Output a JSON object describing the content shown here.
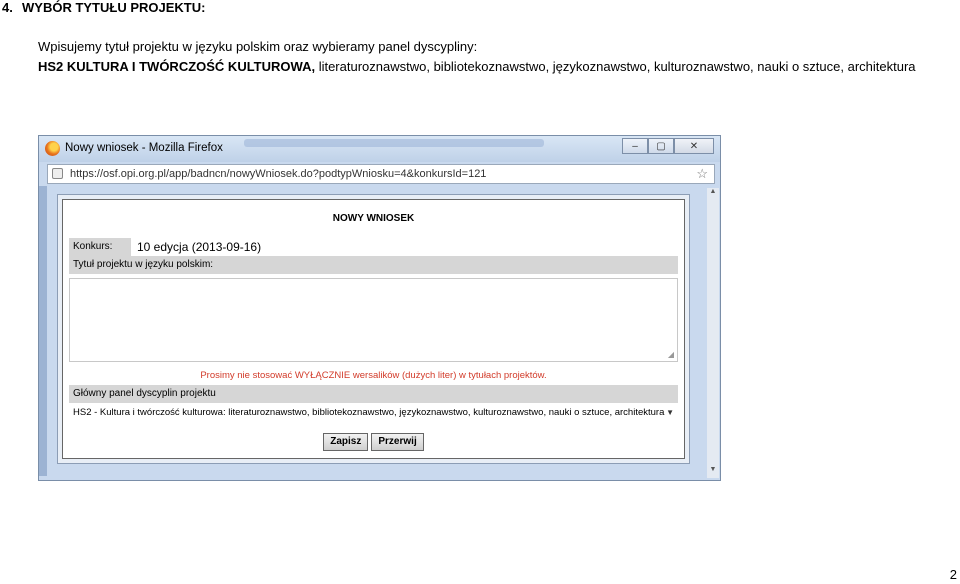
{
  "heading": {
    "number": "4.",
    "title": "WYBÓR TYTUŁU PROJEKTU:"
  },
  "intro": "Wpisujemy tytuł projektu w języku polskim oraz wybieramy panel dyscypliny:",
  "panel_code": "HS2 KULTURA I TWÓRCZOŚĆ KULTUROWA,",
  "panel_disciplines": " literaturoznawstwo, bibliotekoznawstwo, językoznawstwo, kulturoznawstwo, nauki o sztuce, architektura",
  "browser": {
    "window_title": "Nowy wniosek - Mozilla Firefox",
    "url": "https://osf.opi.org.pl/app/badncn/nowyWniosek.do?podtypWniosku=4&konkursId=121",
    "buttons": {
      "minimize": "–",
      "maximize": "▢",
      "close": "✕"
    }
  },
  "form": {
    "title": "NOWY WNIOSEK",
    "konkurs_label": "Konkurs:",
    "konkurs_value": "10 edycja (2013-09-16)",
    "title_label": "Tytuł projektu w języku polskim:",
    "title_value": "",
    "warning": "Prosimy nie stosować WYŁĄCZNIE wersalików (dużych liter) w tytułach projektów.",
    "panel_label": "Główny panel dyscyplin projektu",
    "panel_selected": "HS2 - Kultura i twórczość kulturowa: literaturoznawstwo, bibliotekoznawstwo, językoznawstwo, kulturoznawstwo, nauki o sztuce, architektura",
    "save_label": "Zapisz",
    "cancel_label": "Przerwij"
  },
  "page_number": "2",
  "colors": {
    "warning": "#d23b2a",
    "label_bar": "#d6d6d6",
    "window_chrome": "#c9d9ee"
  },
  "icons": {
    "browser": "firefox-icon",
    "bookmark": "star-icon",
    "dropdown": "triangle-down-icon"
  }
}
